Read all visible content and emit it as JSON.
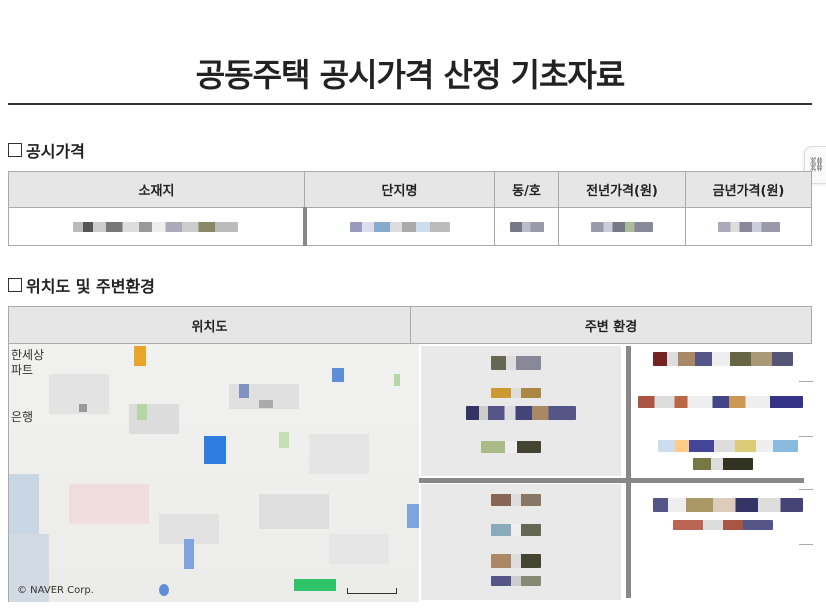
{
  "page": {
    "title": "공동주택 공시가격 산정 기초자료"
  },
  "side_handle": {
    "icon": "link-icon",
    "glyph": "⛓"
  },
  "section1": {
    "title": "공시가격",
    "columns": [
      "소재지",
      "단지명",
      "동/호",
      "전년가격(원)",
      "금년가격(원)"
    ]
  },
  "section2": {
    "title": "위치도 및 주변환경",
    "columns": [
      "위치도",
      "주변 환경"
    ]
  },
  "map": {
    "labels": [
      "한세상",
      "파트",
      "은행"
    ],
    "footer": "© NAVER Corp."
  },
  "colors": {
    "header_bg": "#e6e6e6",
    "border": "#aaaaaa",
    "title_rule": "#333333"
  }
}
